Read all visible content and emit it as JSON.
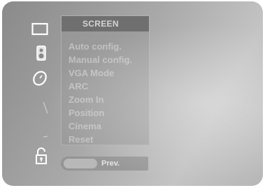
{
  "menu": {
    "title": "SCREEN",
    "items": [
      "Auto config.",
      "Manual config.",
      "VGA Mode",
      "ARC",
      "Zoom In",
      "Position",
      "Cinema",
      "Reset"
    ]
  },
  "footer": {
    "prev_label": "Prev."
  },
  "icons": [
    "screen-menu-icon",
    "audio-speaker-icon",
    "time-clock-icon",
    "special-icon",
    "option-icon",
    "lock-icon"
  ],
  "colors": {
    "osd_background": "#a9a9a9",
    "title_bar": "#6f6f6f",
    "menu_text": "#cdcdcd"
  }
}
